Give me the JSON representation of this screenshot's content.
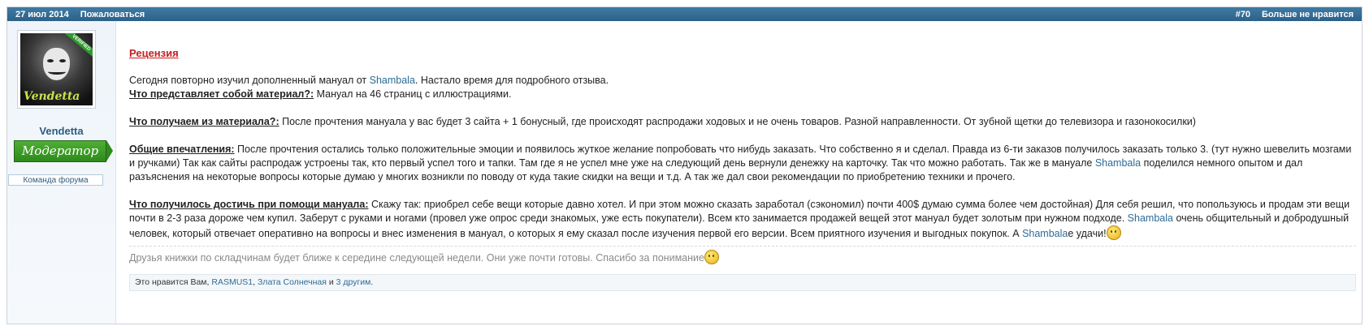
{
  "header": {
    "date": "27 июл 2014",
    "report": "Пожаловаться",
    "post_number": "#70",
    "unlike": "Больше не нравится"
  },
  "author": {
    "avatar_brand": "Vendetta",
    "avatar_ribbon": "VERIFIED",
    "username": "Vendetta",
    "role": "Модератор",
    "team": "Команда форума"
  },
  "body": {
    "heading": "Рецензия",
    "intro": [
      "Сегодня повторно изучил дополненный мануал от ",
      "Shambala",
      ". Настало время для подробного отзыва."
    ],
    "q1_label": "Что представляет собой материал?:",
    "q1_text": " Мануал на 46 страниц с иллюстрациями.",
    "q2_label": "Что получаем из материала?:",
    "q2_text": " После прочтения мануала у вас будет 3 сайта + 1 бонусный, где происходят распродажи ходовых и не очень товаров. Разной направленности. От зубной щетки до телевизора и газонокосилки)",
    "q3_label": "Общие впечатления:",
    "q3_text": " После прочтения остались только положительные эмоции и появилось жуткое желание попробовать что нибудь заказать. Что собственно я и сделал. Правда из 6-ти заказов получилось заказать только 3. (тут нужно шевелить мозгами и ручками) Так как сайты распродаж устроены так, кто первый успел того и тапки. Там где я не успел мне уже на следующий день вернули денежку на карточку. Так что можно работать. Так же в мануале ",
    "q3_link": "Shambala",
    "q3_text2": " поделился немного опытом и дал разъяснения на некоторые вопросы которые думаю у многих возникли по поводу от куда такие скидки на вещи и т.д. А так же дал свои рекомендации по приобретению техники и прочего.",
    "q4_label": "Что получилось достичь при помощи мануала:",
    "q4_text": " Скажу так: приобрел себе вещи которые давно хотел. И при этом можно сказать заработал (сэкономил) почти 400$ думаю сумма более чем достойная) Для себя решил, что попользуюсь и продам эти вещи почти в 2-3 раза дороже чем купил. Заберут с руками и ногами (провел уже опрос среди знакомых, уже есть покупатели). Всем кто занимается продажей вещей этот мануал будет золотым при нужном подходе. ",
    "q4_link": "Shambala",
    "q4_text2": " очень общительный и добродушный человек, который отвечает оперативно на вопросы и внес изменения в мануал, о которых я ему сказал после изучения первой его версии. Всем приятного изучения и выгодных покупок. А ",
    "q4_link2": "Shambala",
    "q4_text3": "e удачи!"
  },
  "signature": "Друзья книжки по складчинам будет ближе к середине следующей недели. Они уже почти готовы. Спасибо за понимание",
  "likes": {
    "prefix": "Это нравится Вам, ",
    "user1": "RASMUS1",
    "sep": ", ",
    "user2": "Злата Солнечная",
    "and": " и ",
    "others": "3 другим",
    "end": "."
  },
  "colors": {
    "header_bg": "#336e98",
    "heading": "#c61e1e",
    "link": "#2d6b96",
    "role_green": "#3a9a27"
  }
}
